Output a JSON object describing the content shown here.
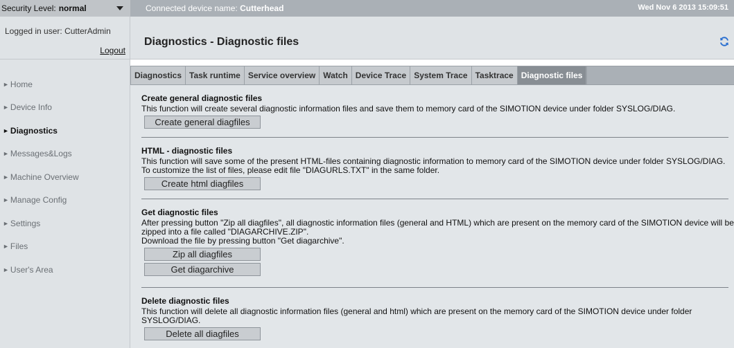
{
  "topbar": {
    "security_label": "Security Level:",
    "security_value": "normal",
    "device_label": "Connected device name:",
    "device_value": "Cutterhead",
    "datetime": "Wed Nov 6 2013  15:09:51"
  },
  "sidebar": {
    "logged_in": "Logged in user: CutterAdmin",
    "logout": "Logout",
    "items": [
      {
        "label": "Home"
      },
      {
        "label": "Device Info"
      },
      {
        "label": "Diagnostics"
      },
      {
        "label": "Messages&Logs"
      },
      {
        "label": "Machine Overview"
      },
      {
        "label": "Manage Config"
      },
      {
        "label": "Settings"
      },
      {
        "label": "Files"
      },
      {
        "label": "User's Area"
      }
    ]
  },
  "header": {
    "title": "Diagnostics - Diagnostic files"
  },
  "tabs": [
    {
      "label": "Diagnostics"
    },
    {
      "label": "Task runtime"
    },
    {
      "label": "Service overview"
    },
    {
      "label": "Watch"
    },
    {
      "label": "Device Trace"
    },
    {
      "label": "System Trace"
    },
    {
      "label": "Tasktrace"
    },
    {
      "label": "Diagnostic files"
    }
  ],
  "sections": {
    "general": {
      "title": "Create general diagnostic files",
      "text": "This function will create several diagnostic information files and save them to memory card of the SIMOTION device under folder SYSLOG/DIAG.",
      "button": "Create general diagfiles"
    },
    "html": {
      "title": "HTML - diagnostic files",
      "text1": "This function will save some of the present HTML-files containing diagnostic information to memory card of the SIMOTION device under folder SYSLOG/DIAG.",
      "text2": "To customize the list of files, please edit file \"DIAGURLS.TXT\" in the same folder.",
      "button": "Create html diagfiles"
    },
    "get": {
      "title": "Get diagnostic files",
      "text1": "After pressing button \"Zip all diagfiles\", all diagnostic information files (general and HTML) which are present on the memory card of the SIMOTION device will be",
      "text2": "zipped into a file called \"DIAGARCHIVE.ZIP\".",
      "text3": "Download the file by pressing button \"Get diagarchive\".",
      "button_zip": "Zip all diagfiles",
      "button_get": "Get diagarchive"
    },
    "delete": {
      "title": "Delete diagnostic files",
      "text1": "This function will delete all diagnostic information files (general and html) which are present on the memory card of the SIMOTION device under folder",
      "text2": "SYSLOG/DIAG.",
      "button": "Delete all diagfiles"
    }
  },
  "active_tab": "Diagnostic files",
  "active_nav": "Diagnostics"
}
